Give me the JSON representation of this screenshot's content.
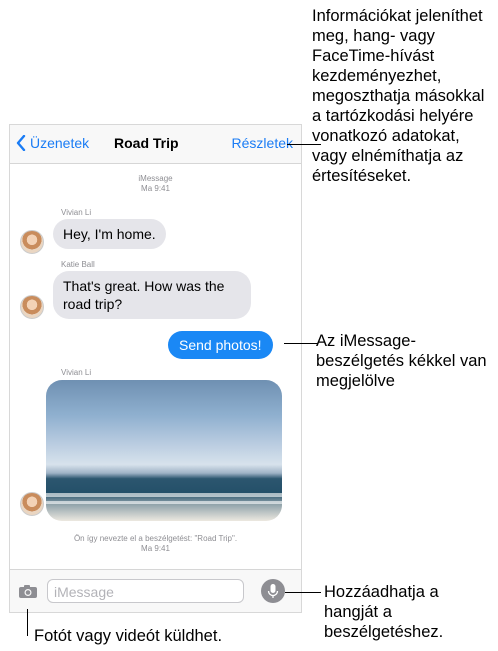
{
  "navbar": {
    "back_label": "Üzenetek",
    "title": "Road Trip",
    "details_label": "Részletek"
  },
  "header_meta": {
    "service": "iMessage",
    "time": "Ma 9:41"
  },
  "messages": [
    {
      "sender": "Vivian Li",
      "text": "Hey, I'm home."
    },
    {
      "sender": "Katie Ball",
      "text": "That's great. How was the road trip?"
    },
    {
      "text": "Send photos!"
    },
    {
      "sender": "Vivian Li"
    }
  ],
  "footer_meta": {
    "text": "Ön így nevezte el a beszélgetést: \"Road Trip\".",
    "time": "Ma 9:41"
  },
  "input": {
    "placeholder": "iMessage"
  },
  "annotations": {
    "details": "Információkat jeleníthet meg, hang- vagy FaceTime-hívást kezdeményezhet, megoszthatja másokkal a tartózkodási helyére vonatkozó adatokat, vagy elnémíthatja az értesítéseket.",
    "imessage": "Az iMessage-beszélgetés kékkel van megjelölve",
    "audio": "Hozzáadhatja a hangját a beszélgetéshez.",
    "camera": "Fotót vagy videót küldhet."
  },
  "colors": {
    "accent": "#1a7cf5",
    "bubble_blue": "#1a88f5",
    "bubble_gray": "#e5e5ea"
  },
  "icons": [
    "chevron-left-icon",
    "camera-icon",
    "microphone-icon"
  ]
}
